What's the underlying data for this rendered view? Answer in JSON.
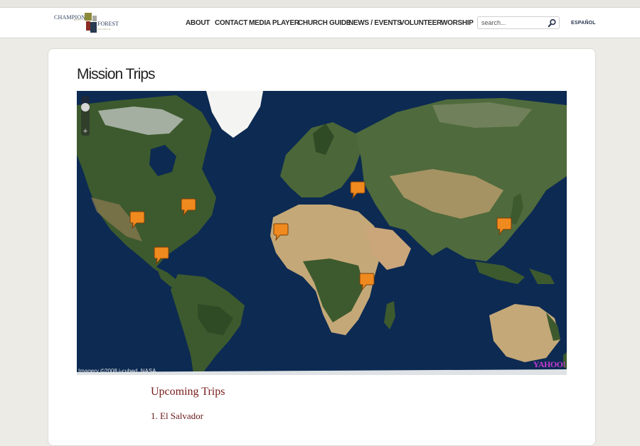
{
  "header": {
    "logo": {
      "line1": "CHAMPION",
      "line2": "BAPTIST",
      "line3": "FOREST",
      "line4": "CHURCH"
    },
    "nav": [
      "ABOUT",
      "CONTACT",
      "MEDIA PLAYER",
      "CHURCH GUIDE",
      "NEWS / EVENTS",
      "VOLUNTEER",
      "WORSHIP"
    ],
    "search": {
      "placeholder": "search..."
    },
    "language_link": "ESPAÑOL"
  },
  "page": {
    "title": "Mission Trips"
  },
  "map": {
    "attribution": "Imagery ©2008 i-cubed, NASA",
    "provider_logo": "YAHOO!",
    "zoom_plus": "+",
    "marker_color": "#f08a1e",
    "water_color": "#0c2a52",
    "land_color": "#3d5a2e",
    "desert_color": "#c4a878"
  },
  "trips": {
    "heading": "Upcoming Trips",
    "items": [
      "1. El Salvador"
    ]
  }
}
